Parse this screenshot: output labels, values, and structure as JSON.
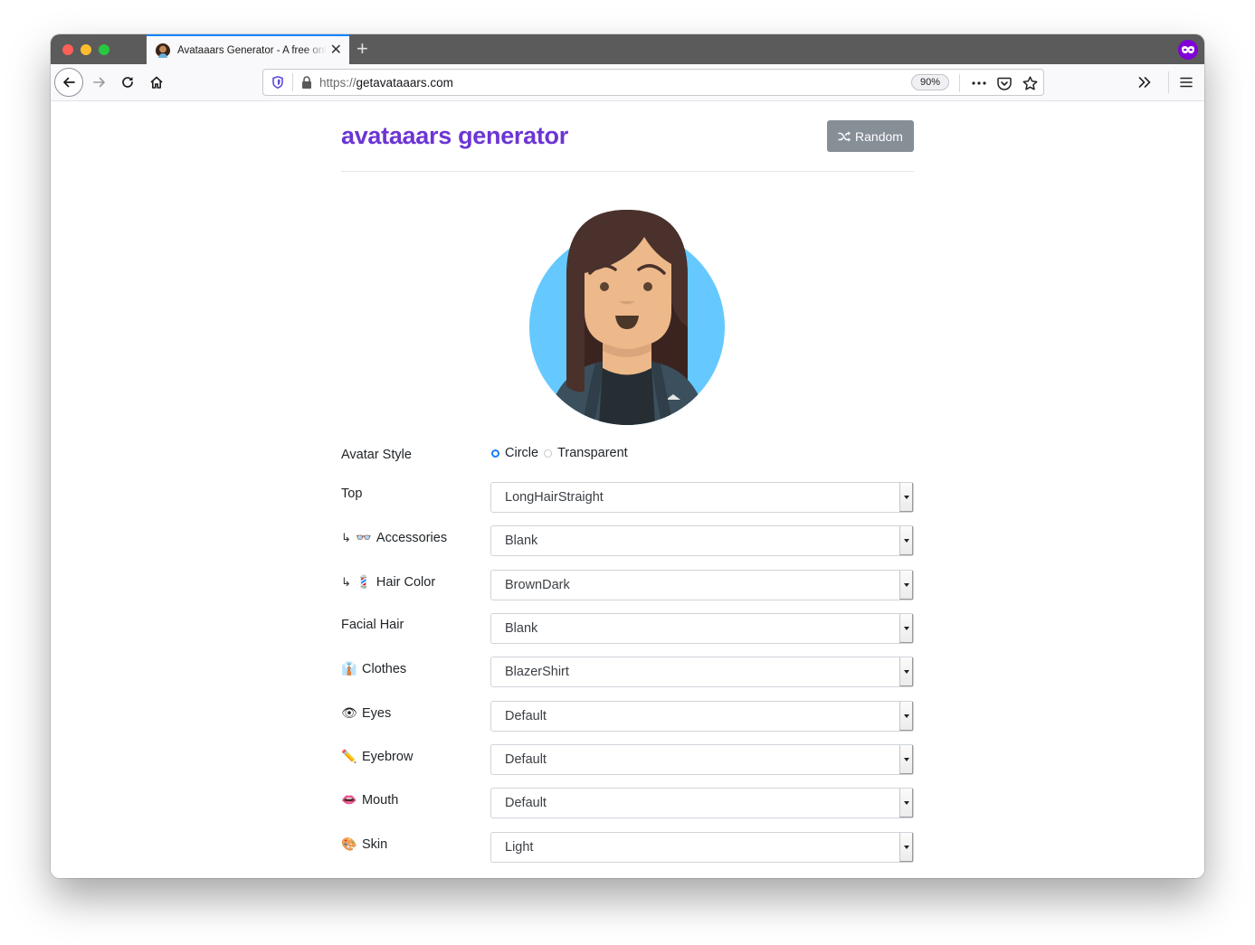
{
  "browser": {
    "tab": {
      "title": "Avataaars Generator - A free online avatar generator",
      "favicon": "avatar-favicon"
    },
    "new_tab_label": "+",
    "url": {
      "scheme": "https://",
      "host": "getavataaars.com"
    },
    "zoom_level": "90%",
    "icons": {
      "back": "arrow-left-icon",
      "forward": "arrow-right-icon",
      "reload": "reload-icon",
      "home": "home-icon",
      "tracking_protection": "shield-icon",
      "lock": "lock-icon",
      "page_actions": "more-horizontal-icon",
      "pocket": "pocket-icon",
      "bookmark": "star-icon",
      "overflow": "chevron-double-right-icon",
      "menu": "hamburger-menu-icon",
      "private": "private-mask-icon"
    }
  },
  "page": {
    "title": "avataaars generator",
    "title_color": "#6c35d3",
    "random_button": {
      "label": "Random",
      "icon": "shuffle-icon",
      "bg_color": "#868e96"
    },
    "avatar": {
      "background_color": "#65c9ff",
      "hair_color": "#4a312c",
      "skin_color": "#edb98a",
      "clothes_color": "#3c4f5c"
    },
    "avatar_style": {
      "label": "Avatar Style",
      "options": [
        {
          "label": "Circle",
          "selected": true
        },
        {
          "label": "Transparent",
          "selected": false
        }
      ]
    },
    "fields": [
      {
        "emoji": "",
        "prefix": "",
        "label": "Top",
        "value": "LongHairStraight"
      },
      {
        "emoji": "👓",
        "prefix": "↳",
        "label": "Accessories",
        "value": "Blank"
      },
      {
        "emoji": "💈",
        "prefix": "↳",
        "label": "Hair Color",
        "value": "BrownDark"
      },
      {
        "emoji": "",
        "prefix": "",
        "label": "Facial Hair",
        "value": "Blank"
      },
      {
        "emoji": "👔",
        "prefix": "",
        "label": "Clothes",
        "value": "BlazerShirt"
      },
      {
        "emoji": "👁",
        "prefix": "",
        "label": "Eyes",
        "value": "Default"
      },
      {
        "emoji": "✏️",
        "prefix": "",
        "label": "Eyebrow",
        "value": "Default"
      },
      {
        "emoji": "👄",
        "prefix": "",
        "label": "Mouth",
        "value": "Default"
      },
      {
        "emoji": "🎨",
        "prefix": "",
        "label": "Skin",
        "value": "Light"
      }
    ]
  }
}
